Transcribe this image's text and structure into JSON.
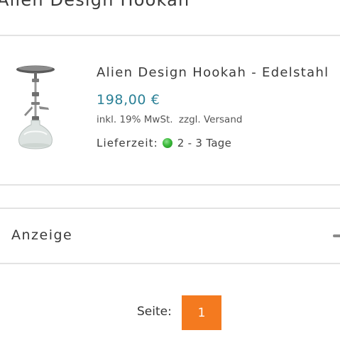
{
  "page": {
    "heading": "Alien Design Hookah"
  },
  "product": {
    "title": "Alien Design Hookah - Edelstahl",
    "price": "198,00 €",
    "tax_note": "inkl. 19% MwSt.",
    "shipping_note": "zzgl. Versand",
    "delivery_label": "Lieferzeit:",
    "delivery_value": "2 - 3 Tage",
    "delivery_status_color": "#3cba3c",
    "image_icon": "hookah-icon"
  },
  "filter": {
    "label": "Anzeige",
    "toggle_icon": "collapse-icon"
  },
  "pagination": {
    "label": "Seite:",
    "current_page": "1",
    "accent": "#f47a1f"
  },
  "colors": {
    "price": "#2a8096",
    "divider": "#e3e3e3"
  }
}
